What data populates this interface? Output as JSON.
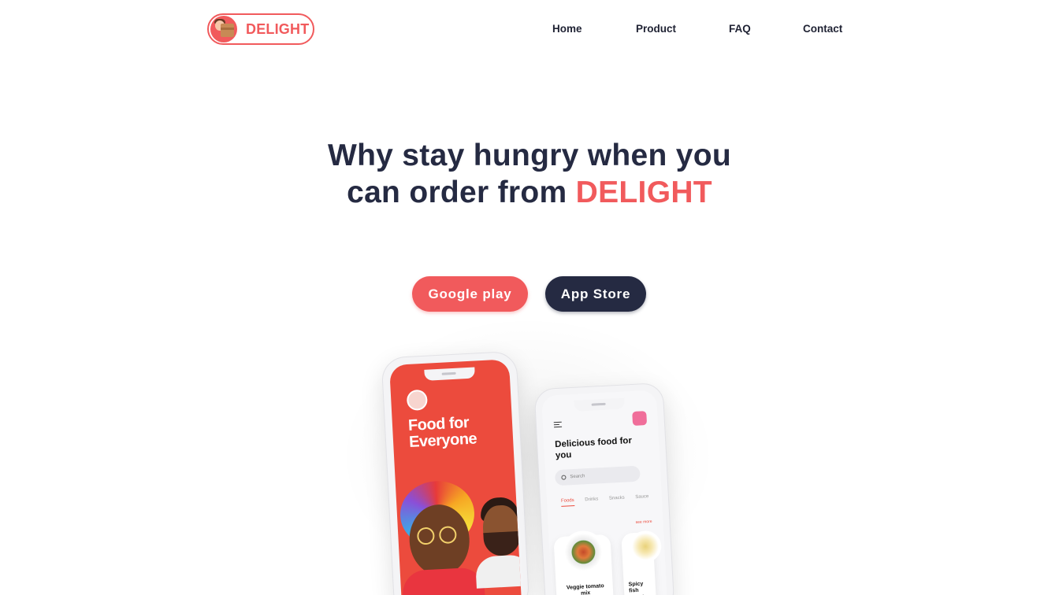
{
  "brand": {
    "name": "DELIGHT",
    "color": "#f15a5c",
    "dark": "#252a42"
  },
  "nav": {
    "home": "Home",
    "product": "Product",
    "faq": "FAQ",
    "contact": "Contact"
  },
  "hero": {
    "line1": "Why stay hungry when you",
    "line2_prefix": "can order from ",
    "line2_accent": "DELIGHT"
  },
  "buttons": {
    "google_play": "Google play",
    "app_store": "App Store"
  },
  "phone_left": {
    "title": "Food for Everyone"
  },
  "phone_right": {
    "title": "Delicious food for you",
    "search_placeholder": "Search",
    "tabs": [
      "Foods",
      "Drinks",
      "Snacks",
      "Sauce"
    ],
    "see_more": "see more",
    "cards": [
      "Veggie tomato mix",
      "Spicy fish sauce"
    ]
  }
}
